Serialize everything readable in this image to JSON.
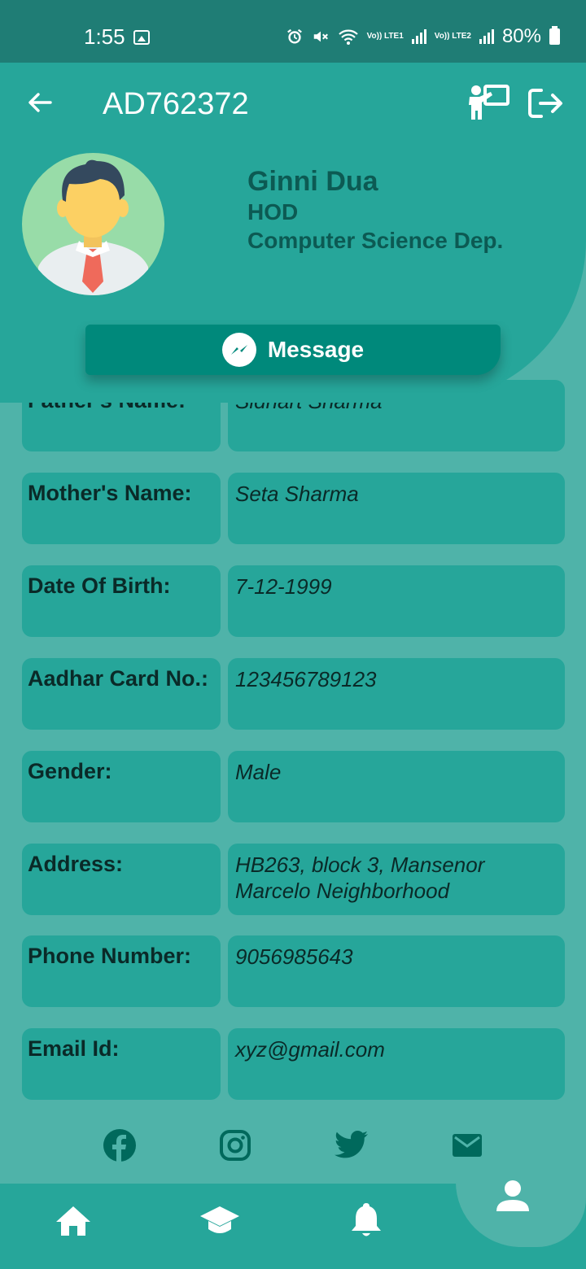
{
  "status_bar": {
    "time": "1:55",
    "network1": "Vo)) LTE1",
    "network2": "Vo)) LTE2",
    "battery": "80%"
  },
  "header": {
    "title": "AD762372",
    "icons": [
      "back-arrow-icon",
      "teacher-board-icon",
      "logout-icon"
    ]
  },
  "profile": {
    "name": "Ginni Dua",
    "role": "HOD",
    "department": "Computer Science Dep.",
    "message_label": "Message"
  },
  "details": [
    {
      "label": "Father's Name:",
      "value": "Sidhart Sharma"
    },
    {
      "label": "Mother's Name:",
      "value": "Seta Sharma"
    },
    {
      "label": "Date Of Birth:",
      "value": "7-12-1999"
    },
    {
      "label": "Aadhar Card No.:",
      "value": "123456789123"
    },
    {
      "label": "Gender:",
      "value": "Male"
    },
    {
      "label": "Address:",
      "value": "HB263, block 3, Mansenor Marcelo Neighborhood"
    },
    {
      "label": "Phone Number:",
      "value": "9056985643"
    },
    {
      "label": "Email Id:",
      "value": "xyz@gmail.com"
    }
  ],
  "social": [
    "facebook-icon",
    "instagram-icon",
    "twitter-icon",
    "email-icon"
  ],
  "bottom_nav": [
    "home-icon",
    "graduation-cap-icon",
    "bell-icon",
    "profile-icon"
  ],
  "colors": {
    "primary": "#26a69a",
    "dark_primary": "#00897b",
    "status_bar": "#1f7d75",
    "background": "#4fb3a9",
    "text_dark": "#0c5a53"
  }
}
